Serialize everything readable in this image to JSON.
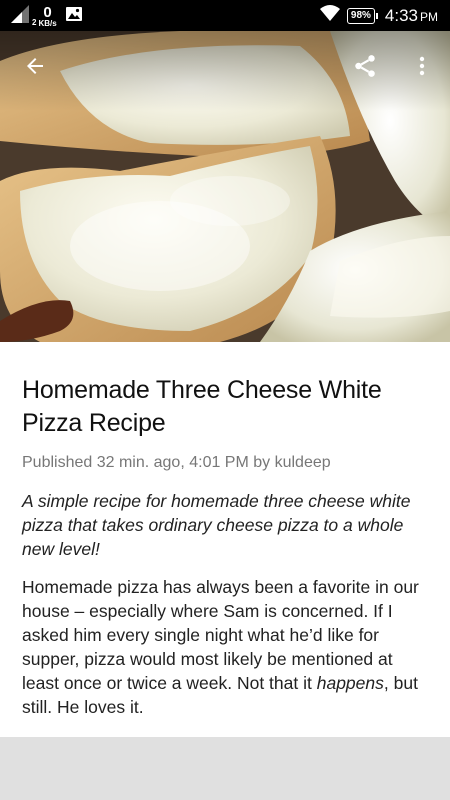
{
  "status_bar": {
    "net_speed": "0",
    "net_unit": "KB/s",
    "sim_slot": "2",
    "battery": "98%",
    "time": "4:33",
    "ampm": "PM",
    "icons": [
      "signal-icon",
      "image-notification-icon",
      "wifi-icon",
      "battery-icon"
    ]
  },
  "hero": {
    "image": "cheese-pizza-photo",
    "actions": [
      "back-arrow-icon",
      "share-icon",
      "more-vert-icon"
    ]
  },
  "article": {
    "title": "Homemade Three Cheese White Pizza Recipe",
    "meta": "Published 32 min. ago, 4:01 PM by kuldeep",
    "excerpt": "A simple recipe for homemade three cheese white pizza that takes ordinary cheese pizza to a whole new level!",
    "body": {
      "part1": "Homemade pizza has always been a favorite in our house – especially where Sam is concerned. If I asked him every single night what he’d like for supper, pizza would most likely be mentioned at least once or twice a week. Not that it ",
      "emphasis": "happens",
      "part2": ", but still. He loves it."
    }
  },
  "colors": {
    "status_bar": "#000000",
    "article_bg": "#ffffff",
    "page_bg": "#e0e0e0",
    "meta_text": "#777777"
  }
}
